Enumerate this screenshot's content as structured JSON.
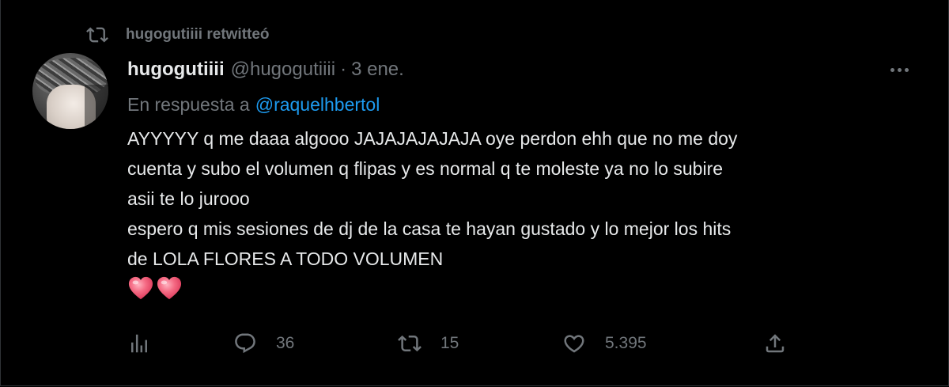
{
  "retweet": {
    "icon": "retweet-icon",
    "text": "hugogutiiii retwitteó"
  },
  "tweet": {
    "author_name": "hugogutiiii",
    "author_handle": "@hugogutiiii",
    "separator": "·",
    "date": "3 ene.",
    "reply_prefix": "En respuesta a",
    "reply_mention": "@raquelhbertol",
    "lines": [
      "AYYYYY q me daaa algooo JAJAJAJAJAJA oye perdon ehh que no me doy",
      "cuenta y subo el volumen q flipas y es normal q te moleste ya no lo subire",
      "asii te lo jurooo",
      "espero q mis sesiones de dj de la casa te hayan gustado y lo mejor los hits",
      "de  LOLA FLORES A TODO VOLUMEN"
    ],
    "emojis": [
      "heart-emoji",
      "heart-emoji"
    ]
  },
  "actions": {
    "analytics": {
      "icon": "analytics-icon"
    },
    "reply": {
      "icon": "reply-icon",
      "count": "36"
    },
    "retweet": {
      "icon": "retweet-icon",
      "count": "15"
    },
    "like": {
      "icon": "heart-icon",
      "count": "5.395"
    },
    "share": {
      "icon": "share-icon"
    }
  },
  "colors": {
    "background": "#000000",
    "text_primary": "#e7e9ea",
    "text_secondary": "#71767b",
    "link": "#1d9bf0",
    "emoji_heart": "#f0607a"
  }
}
